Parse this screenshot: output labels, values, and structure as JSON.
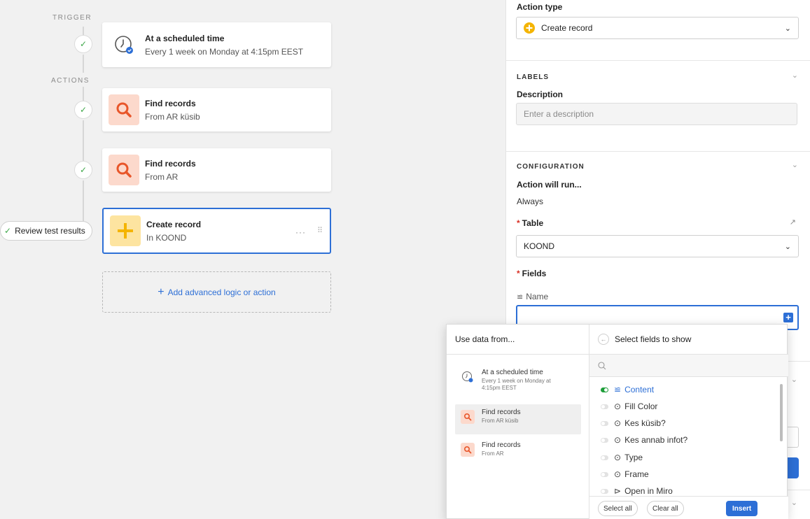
{
  "canvas": {
    "trigger_label": "TRIGGER",
    "actions_label": "ACTIONS",
    "steps": [
      {
        "title": "At a scheduled time",
        "subtitle": "Every 1 week on Monday at 4:15pm EEST",
        "icon": "clock-icon"
      },
      {
        "title": "Find records",
        "subtitle": "From AR küsib",
        "icon": "search-icon"
      },
      {
        "title": "Find records",
        "subtitle": "From AR",
        "icon": "search-icon"
      },
      {
        "title": "Create record",
        "subtitle": "In KOOND",
        "icon": "plus-icon"
      }
    ],
    "card_menu": "···",
    "review_button": "Review test results",
    "add_action": "Add advanced logic or action"
  },
  "panel": {
    "action_type_label": "Action type",
    "action_type_value": "Create record",
    "labels_header": "LABELS",
    "description_label": "Description",
    "description_placeholder": "Enter a description",
    "config_header": "CONFIGURATION",
    "action_will_run_label": "Action will run...",
    "action_will_run_value": "Always",
    "table_label": "Table",
    "table_value": "KOOND",
    "fields_label": "Fields",
    "name_field_label": "Name",
    "required_marker": "*"
  },
  "popover": {
    "left_header": "Use data from...",
    "sources": [
      {
        "title": "At a scheduled time",
        "subtitle": "Every 1 week on Monday at 4:15pm EEST",
        "active": false
      },
      {
        "title": "Find records",
        "subtitle": "From AR küsib",
        "active": true
      },
      {
        "title": "Find records",
        "subtitle": "From AR",
        "active": false
      }
    ],
    "right_header": "Select fields to show",
    "fields": [
      {
        "label": "Content",
        "icon": "long-text-icon",
        "on": true
      },
      {
        "label": "Fill Color",
        "icon": "single-select-icon",
        "on": false
      },
      {
        "label": "Kes küsib?",
        "icon": "single-select-icon",
        "on": false
      },
      {
        "label": "Kes annab infot?",
        "icon": "single-select-icon",
        "on": false
      },
      {
        "label": "Type",
        "icon": "single-select-icon",
        "on": false
      },
      {
        "label": "Frame",
        "icon": "single-select-icon",
        "on": false
      },
      {
        "label": "Open in Miro",
        "icon": "button-icon",
        "on": false
      }
    ],
    "select_all": "Select all",
    "clear_all": "Clear all",
    "insert": "Insert"
  },
  "colors": {
    "accent": "#2d6fd6",
    "success": "#3fa84a",
    "search_icon": "#e8562a",
    "plus_icon": "#f4b400"
  }
}
